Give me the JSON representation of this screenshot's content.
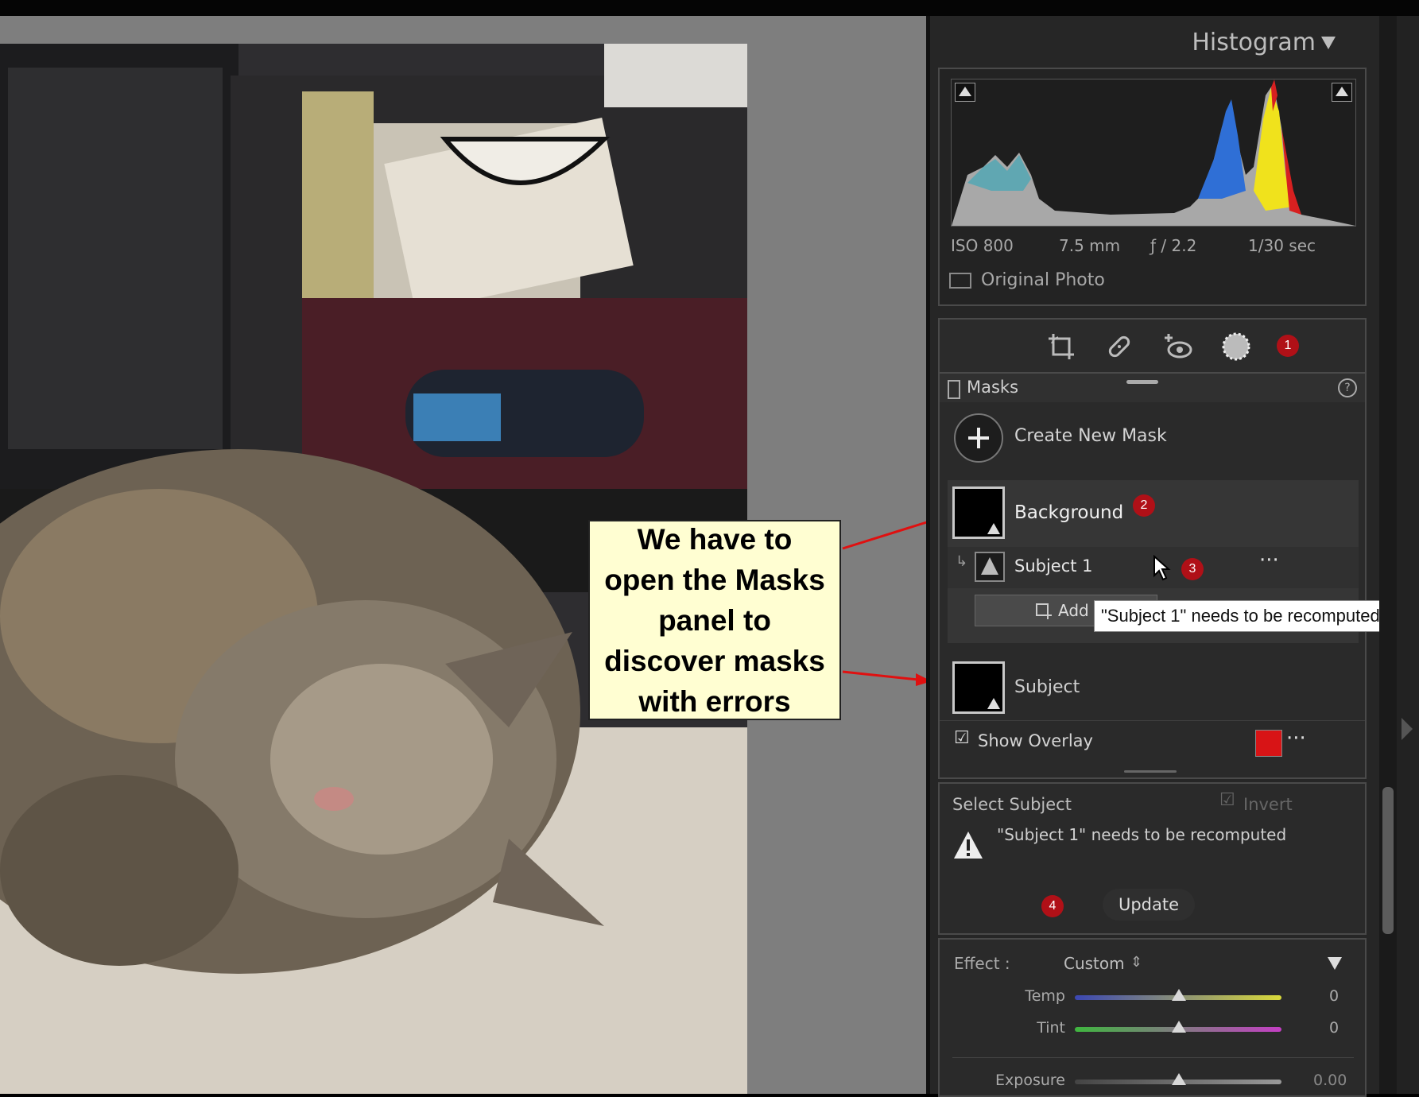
{
  "callout": {
    "text": "We have to open the Masks panel to discover masks with errors"
  },
  "histogram": {
    "title": "Histogram",
    "iso": "ISO 800",
    "focal": "7.5 mm",
    "aperture": "ƒ / 2.2",
    "shutter": "1/30 sec",
    "original_photo": "Original Photo"
  },
  "tools": {
    "icons": [
      "crop-icon",
      "healing-icon",
      "red-eye-icon",
      "masking-icon"
    ],
    "badge_1": "1"
  },
  "masks": {
    "title": "Masks",
    "create_new": "Create New Mask",
    "items": [
      {
        "label": "Background",
        "badge": "2"
      },
      {
        "label": "Subject 1",
        "badge": "3"
      },
      {
        "label": "Subject"
      }
    ],
    "add_button": "Add",
    "show_overlay": "Show Overlay",
    "overlay_color": "#d81416"
  },
  "tooltip": "\"Subject 1\" needs to be recomputed",
  "select_subject": {
    "title": "Select Subject",
    "invert": "Invert",
    "warning": "\"Subject 1\" needs to be recomputed",
    "update": "Update",
    "badge_4": "4"
  },
  "effect": {
    "label": "Effect :",
    "value": "Custom",
    "sliders": [
      {
        "label": "Temp",
        "value": "0"
      },
      {
        "label": "Tint",
        "value": "0"
      },
      {
        "label": "Exposure",
        "value": "0.00"
      }
    ]
  }
}
